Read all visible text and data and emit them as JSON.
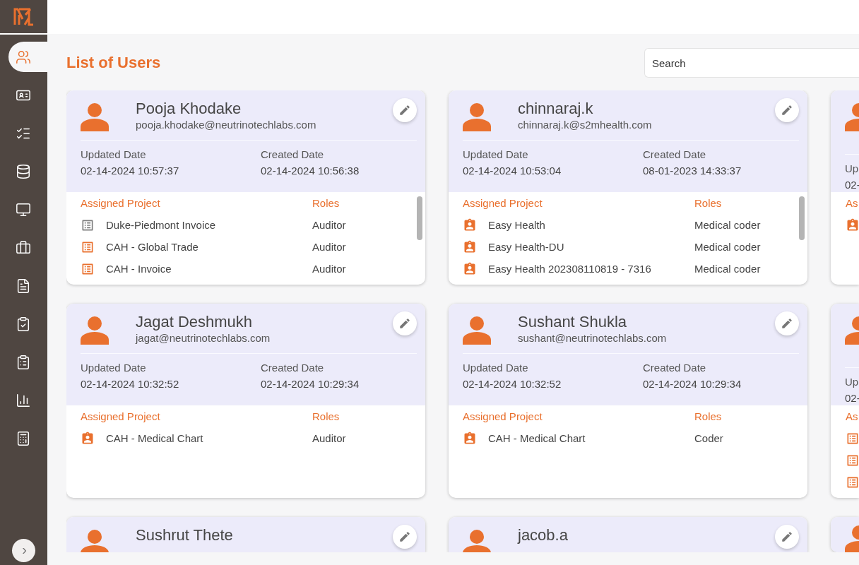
{
  "sidebar": {
    "items": [
      {
        "kind": "users",
        "selected": true
      },
      {
        "kind": "id-card",
        "selected": false
      },
      {
        "kind": "checklist",
        "selected": false
      },
      {
        "kind": "database",
        "selected": false
      },
      {
        "kind": "monitor",
        "selected": false
      },
      {
        "kind": "briefcase",
        "selected": false
      },
      {
        "kind": "document",
        "selected": false
      },
      {
        "kind": "clipboard-check",
        "selected": false
      },
      {
        "kind": "clipboard-list",
        "selected": false
      },
      {
        "kind": "chart",
        "selected": false
      },
      {
        "kind": "calculator",
        "selected": false
      }
    ],
    "expand_button": "›"
  },
  "page": {
    "title": "List of Users",
    "search": {
      "placeholder": "Search"
    }
  },
  "user_cards": [
    {
      "name": "Pooja Khodake",
      "email": "pooja.khodake@neutrinotechlabs.com",
      "updated_label": "Updated Date",
      "updated": "02-14-2024 10:57:37",
      "created_label": "Created Date",
      "created": "02-14-2024 10:56:38",
      "projects_label": "Assigned Project",
      "roles_label": "Roles",
      "projects": [
        {
          "kind": "list",
          "name": "Duke-Piedmont Invoice",
          "role": "Auditor",
          "color": "#7d7d7d"
        },
        {
          "kind": "list",
          "name": "CAH - Global Trade",
          "role": "Auditor",
          "color": "#e9702e"
        },
        {
          "kind": "list",
          "name": "CAH - Invoice",
          "role": "Auditor",
          "color": "#e9702e"
        }
      ]
    },
    {
      "name": "chinnaraj.k",
      "email": "chinnaraj.k@s2mhealth.com",
      "updated_label": "Updated Date",
      "updated": "02-14-2024 10:53:04",
      "created_label": "Created Date",
      "created": "08-01-2023 14:33:37",
      "projects_label": "Assigned Project",
      "roles_label": "Roles",
      "projects": [
        {
          "kind": "badge",
          "name": "Easy Health",
          "role": "Medical coder",
          "color": "#e9702e"
        },
        {
          "kind": "badge",
          "name": "Easy Health-DU",
          "role": "Medical coder",
          "color": "#e9702e"
        },
        {
          "kind": "badge",
          "name": "Easy Health 202308110819 - 7316",
          "role": "Medical coder",
          "color": "#e9702e"
        }
      ]
    },
    {
      "name": "Jagat Deshmukh",
      "email": "jagat@neutrinotechlabs.com",
      "updated_label": "Updated Date",
      "updated": "02-14-2024 10:32:52",
      "created_label": "Created Date",
      "created": "02-14-2024 10:29:34",
      "projects_label": "Assigned Project",
      "roles_label": "Roles",
      "projects": [
        {
          "kind": "badge",
          "name": "CAH - Medical Chart",
          "role": "Auditor",
          "color": "#e9702e"
        }
      ]
    },
    {
      "name": "Sushant Shukla",
      "email": "sushant@neutrinotechlabs.com",
      "updated_label": "Updated Date",
      "updated": "02-14-2024 10:32:52",
      "created_label": "Created Date",
      "created": "02-14-2024 10:29:34",
      "projects_label": "Assigned Project",
      "roles_label": "Roles",
      "projects": [
        {
          "kind": "badge",
          "name": "CAH - Medical Chart",
          "role": "Coder",
          "color": "#e9702e"
        }
      ]
    }
  ],
  "cut_cards": [
    {
      "kind": "partial",
      "updated_label": "Up",
      "updated": "02-",
      "projects_label": "As",
      "projects": [
        {
          "kind": "badge",
          "color": "#e9702e"
        }
      ]
    },
    {
      "kind": "partial",
      "updated_label": "Up",
      "updated": "02-",
      "projects_label": "As",
      "projects": [
        {
          "kind": "list",
          "color": "#e9702e"
        },
        {
          "kind": "list",
          "color": "#e9702e"
        },
        {
          "kind": "list",
          "color": "#e9702e"
        }
      ]
    },
    {
      "kind": "avatar-only"
    }
  ],
  "lower_cards": [
    {
      "name": "Sushrut Thete"
    },
    {
      "name": "jacob.a"
    }
  ]
}
